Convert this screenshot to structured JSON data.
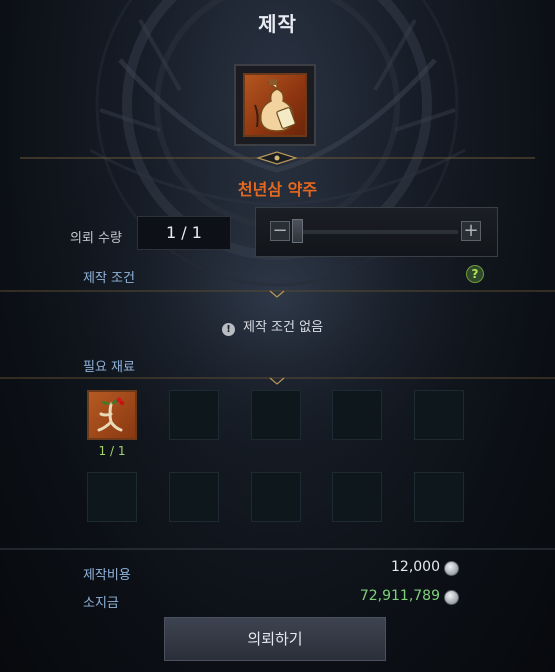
{
  "window": {
    "title": "제작"
  },
  "item": {
    "name": "천년삼 약주",
    "icon": "gourd-bottle-icon"
  },
  "quantity": {
    "label": "의뢰 수량",
    "value": "1 / 1",
    "slider_min_symbol": "−",
    "slider_max_symbol": "+",
    "slider_level": 0
  },
  "conditions": {
    "title": "제작 조건",
    "help_symbol": "?",
    "info_symbol": "!",
    "empty_text": "제작 조건 없음"
  },
  "materials": {
    "title": "필요 재료",
    "slots": [
      {
        "icon": "ginseng-icon",
        "count": "1 / 1"
      },
      {},
      {},
      {},
      {},
      {},
      {},
      {},
      {},
      {}
    ]
  },
  "cost": {
    "label": "제작비용",
    "value": "12,000"
  },
  "money": {
    "label": "소지금",
    "value": "72,911,789"
  },
  "colors": {
    "item_name": "#e4681f",
    "section_title": "#8fb3da",
    "money_value": "#7fd07a",
    "material_count": "#a4d46a"
  },
  "actions": {
    "request_label": "의뢰하기"
  }
}
